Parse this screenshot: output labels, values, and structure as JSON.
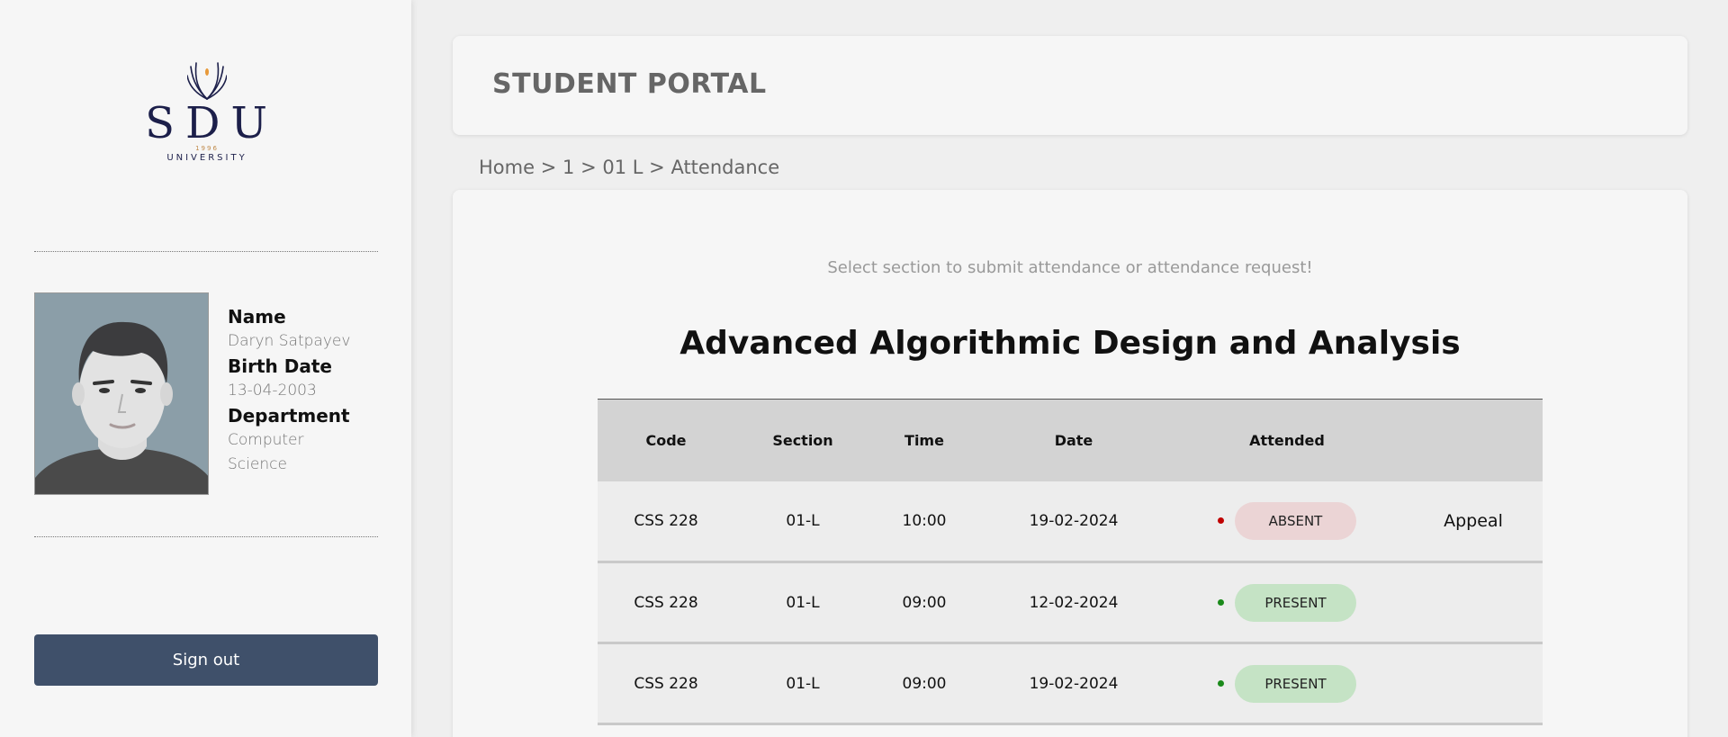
{
  "sidebar": {
    "logo": {
      "letters": "SDU",
      "year": "1996",
      "subtitle": "UNIVERSITY"
    },
    "profile": {
      "name_label": "Name",
      "name_value": "Daryn Satpayev",
      "birth_label": "Birth Date",
      "birth_value": "13-04-2003",
      "dept_label": "Department",
      "dept_value_line1": "Computer",
      "dept_value_line2": "Science"
    },
    "signout_label": "Sign out"
  },
  "header": {
    "title": "STUDENT PORTAL"
  },
  "breadcrumb": {
    "home": "Home",
    "sep": ">",
    "level1": "1",
    "level2": "01 L",
    "current": "Attendance"
  },
  "main": {
    "hint": "Select section to submit attendance or attendance request!",
    "course_title": "Advanced Algorithmic Design and Analysis",
    "table": {
      "headers": {
        "code": "Code",
        "section": "Section",
        "time": "Time",
        "date": "Date",
        "attended": "Attended"
      },
      "rows": [
        {
          "code": "CSS 228",
          "section": "01-L",
          "time": "10:00",
          "date": "19-02-2024",
          "status": "ABSENT",
          "appeal": "Appeal"
        },
        {
          "code": "CSS 228",
          "section": "01-L",
          "time": "09:00",
          "date": "12-02-2024",
          "status": "PRESENT",
          "appeal": ""
        },
        {
          "code": "CSS 228",
          "section": "01-L",
          "time": "09:00",
          "date": "19-02-2024",
          "status": "PRESENT",
          "appeal": ""
        }
      ]
    }
  },
  "colors": {
    "sidebar_bg": "#f6f6f6",
    "page_bg": "#efefef",
    "signout_bg": "#3f506a",
    "logo_navy": "#1c1f4a",
    "absent_badge": "#ebd4d5",
    "absent_dot": "#c00000",
    "present_badge": "#c5e3c5",
    "present_dot": "#1a8a1a"
  }
}
